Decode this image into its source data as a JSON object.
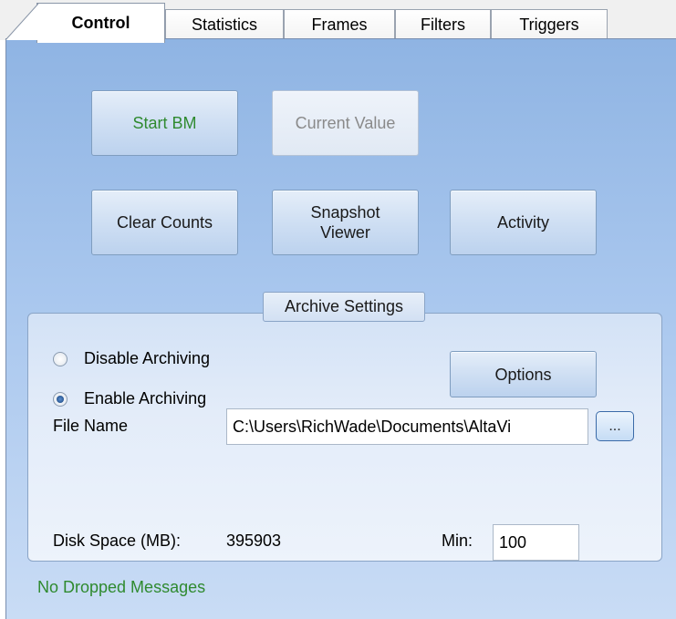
{
  "tabs": [
    {
      "label": "Control",
      "active": true
    },
    {
      "label": "Statistics",
      "active": false
    },
    {
      "label": "Frames",
      "active": false
    },
    {
      "label": "Filters",
      "active": false
    },
    {
      "label": "Triggers",
      "active": false
    }
  ],
  "buttons": {
    "start": "Start BM",
    "current_value": "Current Value",
    "clear_counts": "Clear Counts",
    "snapshot_viewer": "Snapshot Viewer",
    "activity": "Activity",
    "options": "Options",
    "browse": "..."
  },
  "archive": {
    "title": "Archive Settings",
    "disable_label": "Disable Archiving",
    "enable_label": "Enable Archiving",
    "selected": "enable",
    "file_name_label": "File Name",
    "file_name_value": "C:\\Users\\RichWade\\Documents\\AltaVi",
    "disk_space_label": "Disk Space (MB):",
    "disk_space_value": "395903",
    "min_label": "Min:",
    "min_value": "100"
  },
  "status_text": "No Dropped Messages",
  "colors": {
    "panel_top": "#8fb4e3",
    "panel_bottom": "#c9dcf5",
    "status_green": "#2f8a2f",
    "start_green": "#2f8a2f",
    "disabled_gray": "#8a8a8a"
  }
}
